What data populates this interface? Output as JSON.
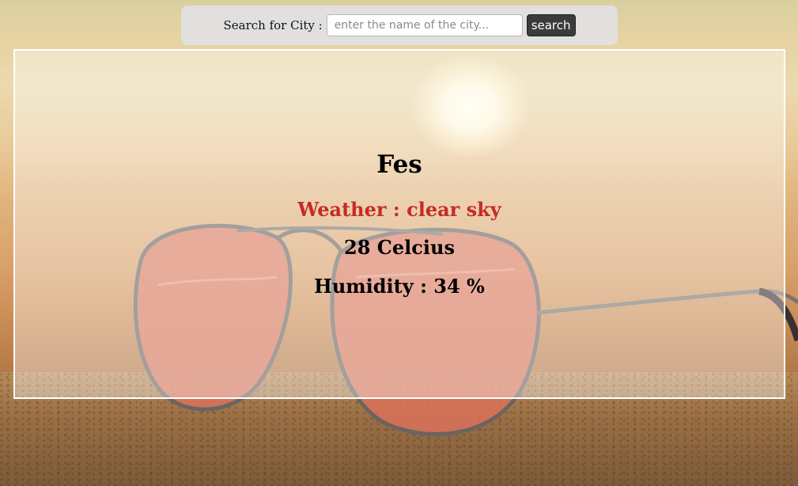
{
  "search": {
    "label": "Search for City :",
    "placeholder": "enter the name of the city...",
    "value": "",
    "button_label": "search"
  },
  "weather": {
    "city": "Fes",
    "condition_text": "Weather : clear sky",
    "temperature_text": "28 Celcius",
    "humidity_text": "Humidity : 34 %"
  },
  "colors": {
    "searchbar_bg": "#e2dfdf",
    "button_bg": "#3b3b3b",
    "condition_text": "#c62a27",
    "panel_border": "#ffffff"
  }
}
